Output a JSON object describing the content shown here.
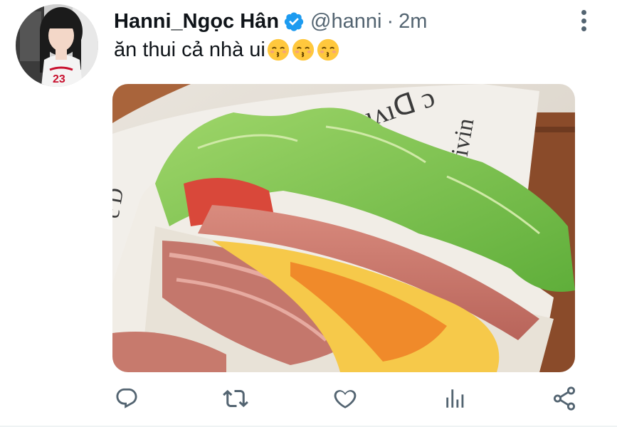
{
  "tweet": {
    "display_name": "Hanni_Ngọc Hân",
    "handle": "@hanni",
    "separator": "·",
    "time": "2m",
    "text": "ăn thui cả nhà ui",
    "emojis": [
      "kissing-face-with-smiling-eyes",
      "kissing-face-with-smiling-eyes",
      "kissing-face-with-smiling-eyes"
    ]
  },
  "icons": {
    "verified": "verified-badge-icon",
    "more": "more-vertical-icon",
    "reply": "reply-icon",
    "retweet": "retweet-icon",
    "like": "heart-icon",
    "analytics": "analytics-icon",
    "share": "share-icon"
  },
  "colors": {
    "accent": "#1d9bf0",
    "icon_gray": "#536471",
    "text": "#0f1419"
  }
}
